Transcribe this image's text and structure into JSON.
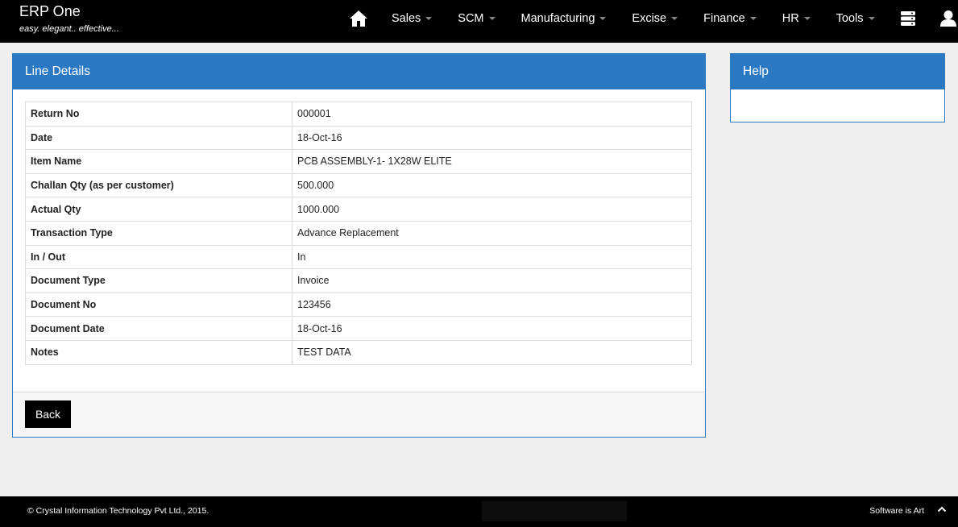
{
  "app": {
    "title": "ERP One",
    "tagline": "easy. elegant.. effective..."
  },
  "nav": {
    "home_icon": "home-icon",
    "items": [
      {
        "label": "Sales"
      },
      {
        "label": "SCM"
      },
      {
        "label": "Manufacturing"
      },
      {
        "label": "Excise"
      },
      {
        "label": "Finance"
      },
      {
        "label": "HR"
      },
      {
        "label": "Tools"
      }
    ],
    "right_icons": [
      "server-stack-icon",
      "user-icon"
    ]
  },
  "line_details": {
    "heading": "Line Details",
    "rows": [
      {
        "label": "Return No",
        "value": "000001"
      },
      {
        "label": "Date",
        "value": "18-Oct-16"
      },
      {
        "label": "Item Name",
        "value": "PCB ASSEMBLY-1- 1X28W ELITE"
      },
      {
        "label": "Challan Qty (as per customer)",
        "value": "500.000"
      },
      {
        "label": "Actual Qty",
        "value": "1000.000"
      },
      {
        "label": "Transaction Type",
        "value": "Advance Replacement"
      },
      {
        "label": "In / Out",
        "value": "In"
      },
      {
        "label": "Document Type",
        "value": "Invoice"
      },
      {
        "label": "Document No",
        "value": "123456"
      },
      {
        "label": "Document Date",
        "value": "18-Oct-16"
      },
      {
        "label": "Notes",
        "value": "TEST DATA"
      }
    ],
    "back_label": "Back"
  },
  "help": {
    "heading": "Help"
  },
  "footer": {
    "copyright": "© Crystal Information Technology Pvt Ltd., 2015.",
    "slogan": "Software is Art"
  },
  "colors": {
    "accent": "#2a79c2",
    "navbar": "#000000",
    "background": "#efefef"
  }
}
